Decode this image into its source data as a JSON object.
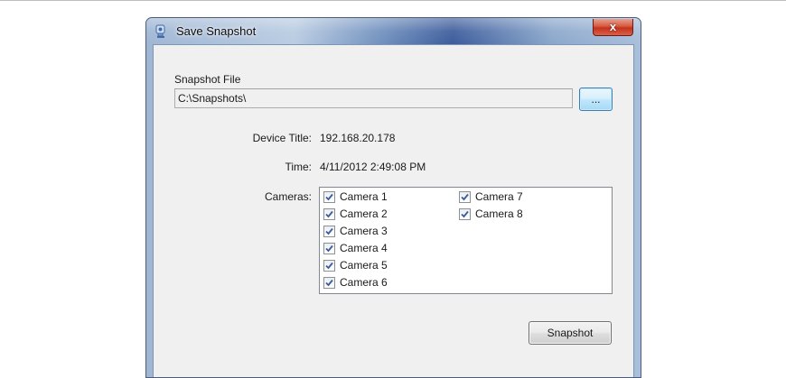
{
  "window": {
    "title": "Save Snapshot",
    "close_glyph": "x",
    "icon": "camera-app-icon"
  },
  "snapshot_file": {
    "label": "Snapshot File",
    "value": "C:\\Snapshots\\",
    "browse_label": "..."
  },
  "device": {
    "label": "Device Title:",
    "value": "192.168.20.178"
  },
  "time": {
    "label": "Time:",
    "value": "4/11/2012 2:49:08 PM"
  },
  "cameras": {
    "label": "Cameras:",
    "items": [
      {
        "label": "Camera 1",
        "checked": true
      },
      {
        "label": "Camera 2",
        "checked": true
      },
      {
        "label": "Camera 3",
        "checked": true
      },
      {
        "label": "Camera 4",
        "checked": true
      },
      {
        "label": "Camera 5",
        "checked": true
      },
      {
        "label": "Camera 6",
        "checked": true
      },
      {
        "label": "Camera 7",
        "checked": true
      },
      {
        "label": "Camera 8",
        "checked": true
      }
    ]
  },
  "actions": {
    "snapshot_label": "Snapshot"
  },
  "colors": {
    "checkmark": "#3b5b9a",
    "close_button": "#c4321b"
  }
}
